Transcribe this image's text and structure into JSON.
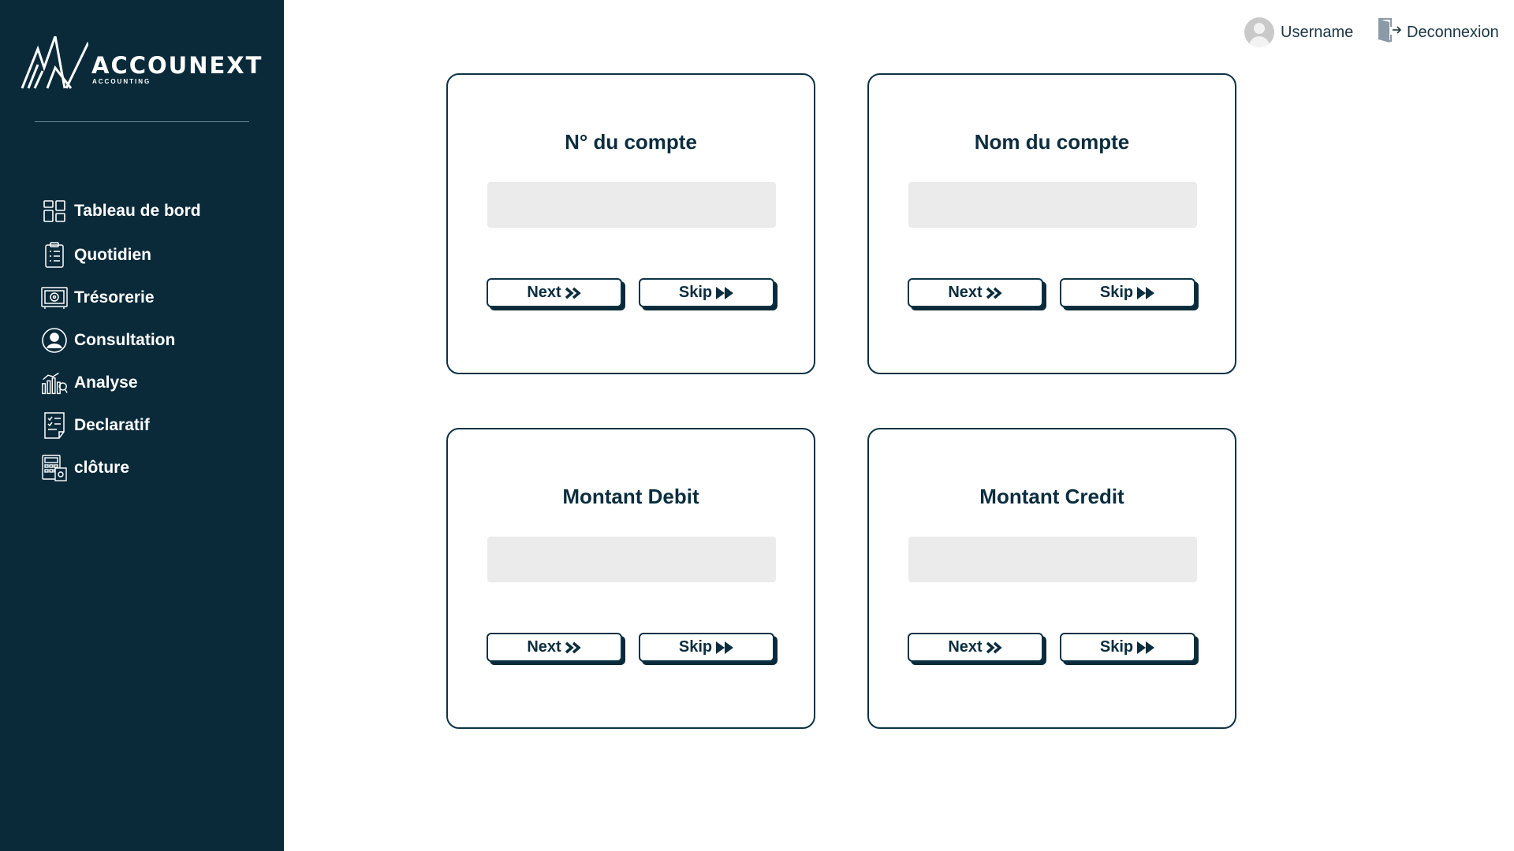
{
  "brand": {
    "name": "ACCOUNEXT",
    "tagline": "ACCOUNTING"
  },
  "colors": {
    "sidebar_bg": "#0a2a3a",
    "accent": "#0d3245",
    "input_bg": "#ebebeb"
  },
  "sidebar": {
    "items": [
      {
        "label": "Tableau de bord",
        "icon": "dashboard-icon"
      },
      {
        "label": "Quotidien",
        "icon": "clipboard-list-icon"
      },
      {
        "label": "Trésorerie",
        "icon": "safe-icon"
      },
      {
        "label": "Consultation",
        "icon": "user-circle-icon"
      },
      {
        "label": "Analyse",
        "icon": "chart-search-icon"
      },
      {
        "label": "Declaratif",
        "icon": "document-checklist-icon"
      },
      {
        "label": "clôture",
        "icon": "calculator-document-icon"
      }
    ]
  },
  "header": {
    "username": "Username",
    "logout_label": "Deconnexion"
  },
  "cards": [
    {
      "title": "N° du compte",
      "value": "",
      "next_label": "Next",
      "skip_label": "Skip"
    },
    {
      "title": "Nom du compte",
      "value": "",
      "next_label": "Next",
      "skip_label": "Skip"
    },
    {
      "title": "Montant Debit",
      "value": "",
      "next_label": "Next",
      "skip_label": "Skip"
    },
    {
      "title": "Montant Credit",
      "value": "",
      "next_label": "Next",
      "skip_label": "Skip"
    }
  ]
}
